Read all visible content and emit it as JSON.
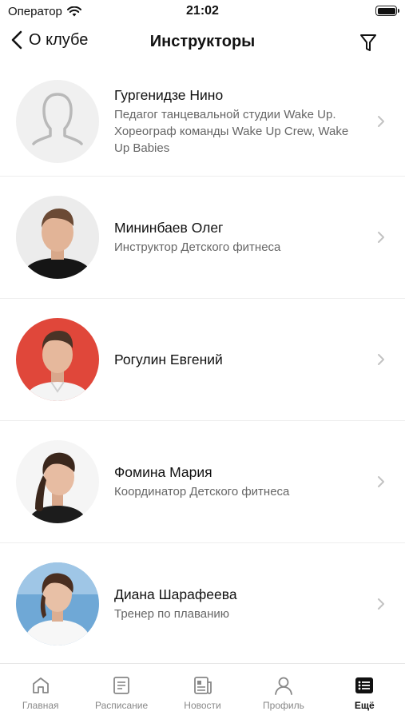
{
  "status_bar": {
    "carrier": "Оператор",
    "time": "21:02"
  },
  "nav": {
    "back_label": "О клубе",
    "title": "Инструкторы"
  },
  "instructors": [
    {
      "name": "Гургенидзе Нино",
      "description": "Педагог танцевальной студии Wake Up. Хореограф команды Wake Up Crew, Wake Up Babies"
    },
    {
      "name": "Мининбаев Олег",
      "description": "Инструктор Детского фитнеса"
    },
    {
      "name": "Рогулин Евгений",
      "description": ""
    },
    {
      "name": "Фомина Мария",
      "description": "Координатор Детского фитнеса"
    },
    {
      "name": "Диана Шарафеева",
      "description": "Тренер по плаванию"
    }
  ],
  "tabs": [
    {
      "label": "Главная",
      "icon": "home-icon"
    },
    {
      "label": "Расписание",
      "icon": "schedule-icon"
    },
    {
      "label": "Новости",
      "icon": "news-icon"
    },
    {
      "label": "Профиль",
      "icon": "profile-icon"
    },
    {
      "label": "Ещё",
      "icon": "more-icon",
      "active": true
    }
  ],
  "colors": {
    "accent": "#111111",
    "muted": "#888888",
    "divider": "#eeeeee",
    "avatar_red_bg": "#e0473a"
  }
}
